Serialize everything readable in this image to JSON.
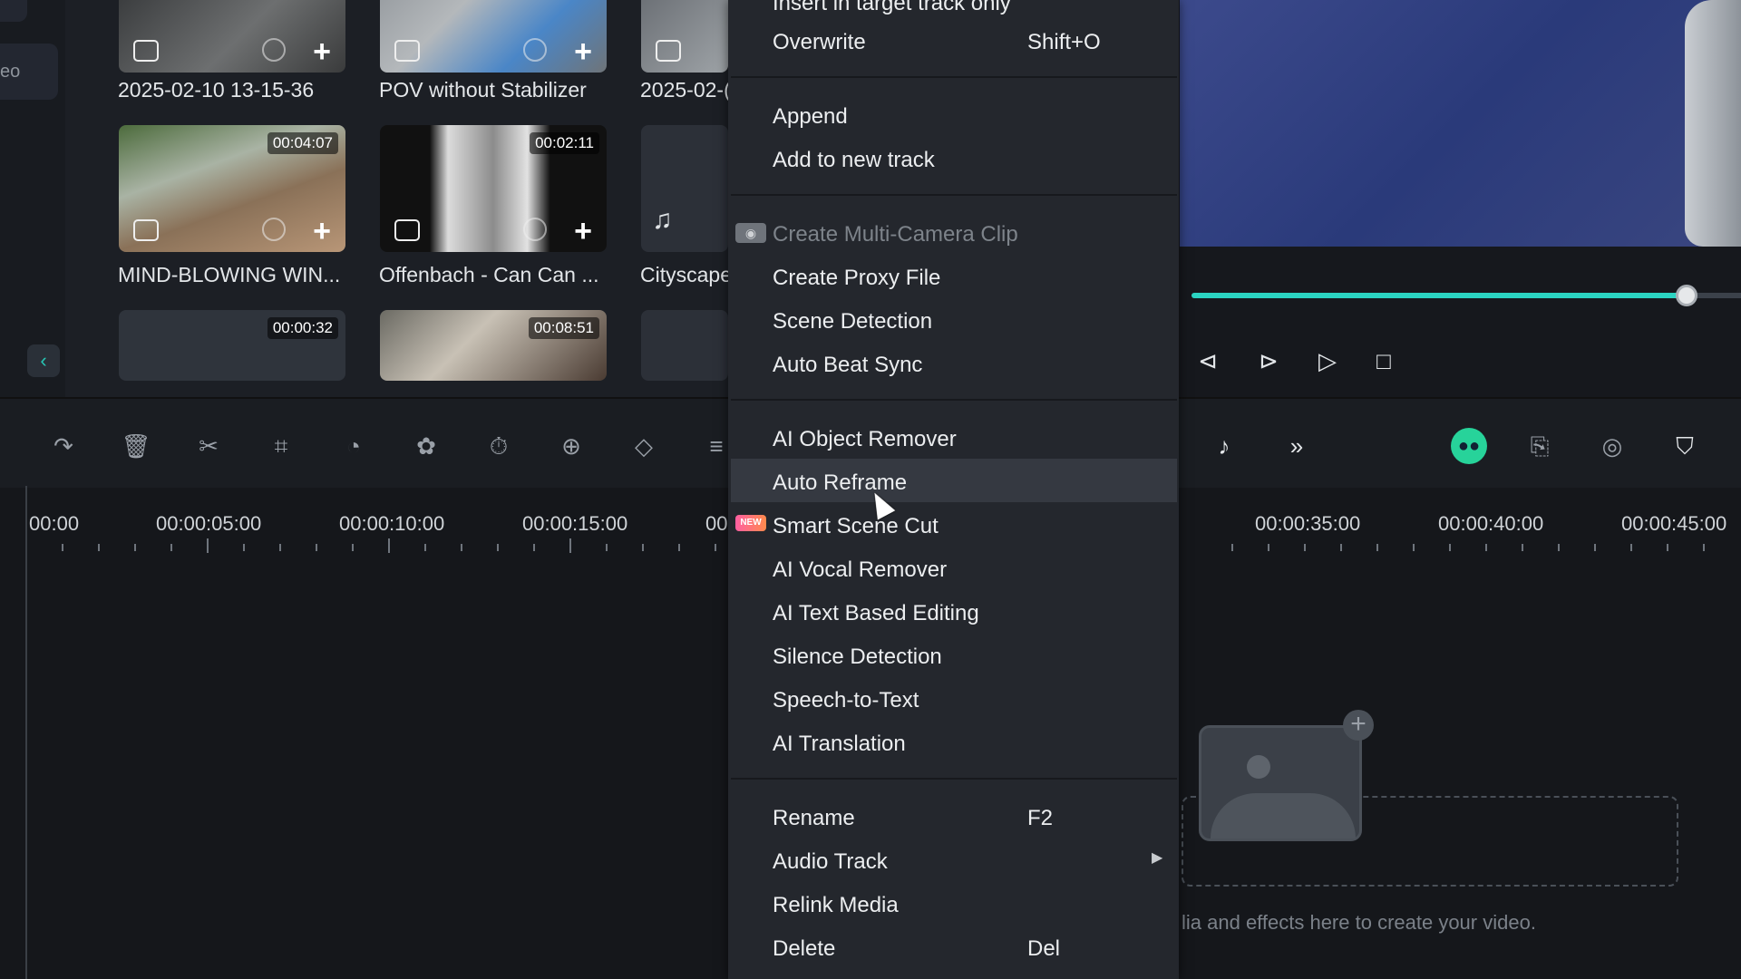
{
  "media": {
    "rail_label": "eo",
    "back_icon": "chevron-left-icon",
    "items": [
      {
        "title": "2025-02-10 13-15-36",
        "duration": ""
      },
      {
        "title": "POV without Stabilizer",
        "duration": ""
      },
      {
        "title": "2025-02-(",
        "duration": ""
      },
      {
        "title": "MIND-BLOWING WIN...",
        "duration": "00:04:07"
      },
      {
        "title": "Offenbach - Can Can ...",
        "duration": "00:02:11"
      },
      {
        "title": "Cityscape",
        "duration": ""
      },
      {
        "title": "",
        "duration": "00:00:32"
      },
      {
        "title": "",
        "duration": "00:08:51"
      }
    ]
  },
  "preview": {
    "progress": 0.97,
    "controls": [
      "prev-frame-icon",
      "next-frame-icon",
      "play-icon",
      "stop-icon"
    ]
  },
  "toolbar": {
    "tools": [
      "redo-icon",
      "delete-icon",
      "cut-icon",
      "crop-icon",
      "speed-icon",
      "color-icon",
      "timer-icon",
      "ai-crop-icon",
      "keyframe-icon",
      "adjust-icon",
      "audio-ai-icon",
      "more-icon",
      "ai-assistant-icon",
      "add-clip-icon",
      "render-icon",
      "shield-icon"
    ]
  },
  "timeline": {
    "ruler_left": [
      "00:00",
      "00:00:05:00",
      "00:00:10:00",
      "00:00:15:00",
      "00"
    ],
    "ruler_right": [
      "00:00:35:00",
      "00:00:40:00",
      "00:00:45:00"
    ],
    "drop_hint": "lia and effects here to create your video."
  },
  "context_menu": {
    "insert_partial": "Insert in target track only",
    "overwrite": {
      "label": "Overwrite",
      "shortcut": "Shift+O"
    },
    "append": "Append",
    "add_new_track": "Add to new track",
    "multicam": "Create Multi-Camera Clip",
    "proxy": "Create Proxy File",
    "scene": "Scene Detection",
    "beat": "Auto Beat Sync",
    "object_remover": "AI Object Remover",
    "auto_reframe": "Auto Reframe",
    "smart_cut": "Smart Scene Cut",
    "new_badge": "NEW",
    "vocal": "AI Vocal Remover",
    "text_editing": "AI Text Based Editing",
    "silence": "Silence Detection",
    "stt": "Speech-to-Text",
    "translation": "AI Translation",
    "rename": {
      "label": "Rename",
      "shortcut": "F2"
    },
    "audio_track": "Audio Track",
    "relink": "Relink Media",
    "delete": {
      "label": "Delete",
      "shortcut": "Del"
    }
  }
}
